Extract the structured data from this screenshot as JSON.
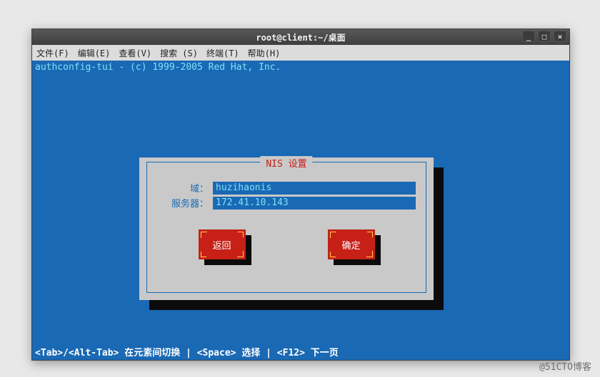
{
  "window": {
    "title": "root@client:~/桌面",
    "controls": {
      "min": "_",
      "max": "□",
      "close": "×"
    }
  },
  "menubar": {
    "items": [
      "文件(F)",
      "编辑(E)",
      "查看(V)",
      "搜索 (S)",
      "终端(T)",
      "帮助(H)"
    ]
  },
  "terminal": {
    "header": "authconfig-tui - (c) 1999-2005 Red Hat,  Inc."
  },
  "dialog": {
    "title": "NIS 设置",
    "fields": {
      "domain_label": "域：",
      "domain_value": "huzihaonis",
      "server_label": "服务器：",
      "server_value": "172.41.10.143"
    },
    "buttons": {
      "back": "返回",
      "ok": "确定"
    }
  },
  "footer": {
    "text": "<Tab>/<Alt-Tab> 在元素间切换    |    <Space> 选择    |   <F12> 下一页"
  },
  "watermark": "@51CTO博客"
}
